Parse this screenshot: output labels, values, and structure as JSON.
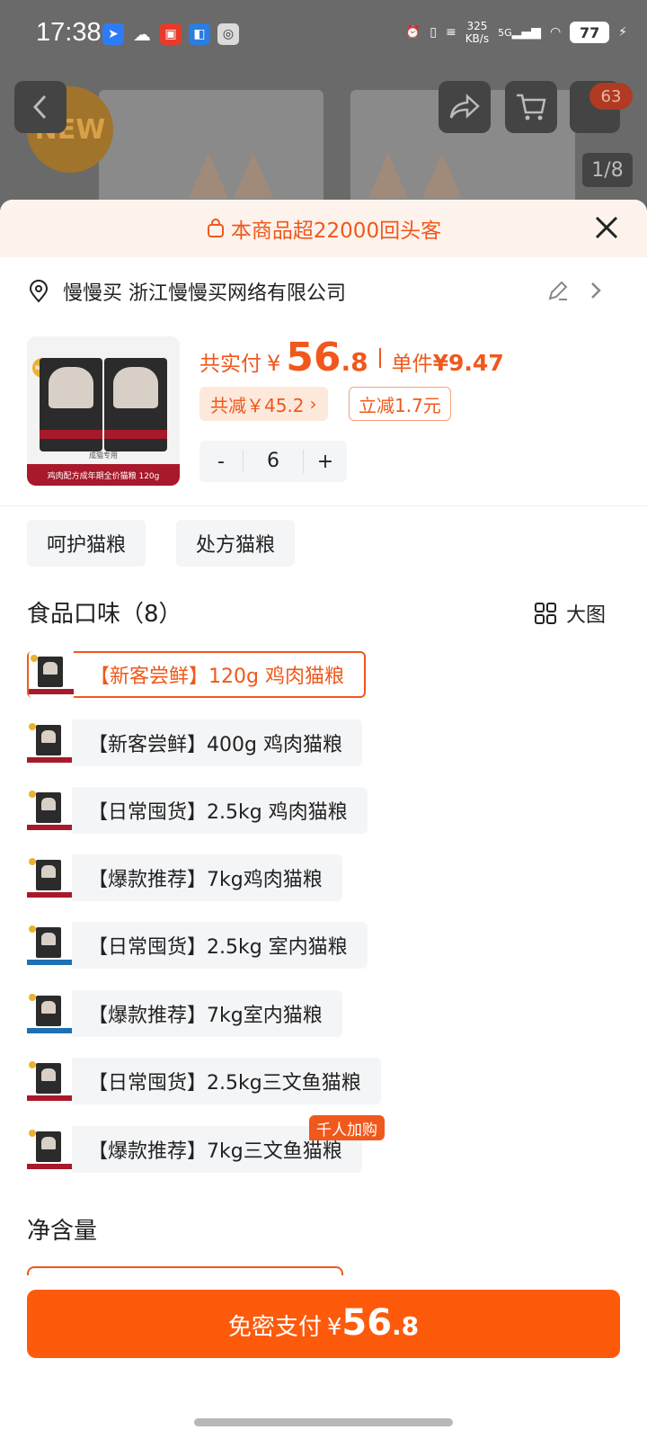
{
  "status_bar": {
    "time": "17:38",
    "net_speed_value": "325",
    "net_speed_unit": "KB/s",
    "network": "5G",
    "battery": "77"
  },
  "background": {
    "new_badge": "NEW",
    "cart_count": "63",
    "image_page": "1/8"
  },
  "banner": {
    "text": "本商品超22000回头客"
  },
  "address": {
    "text": "慢慢买 浙江慢慢买网络有限公司"
  },
  "product_image": {
    "badge": "NEW",
    "pack_subtitle": "成猫专用",
    "ribbon": "鸡肉配方成年期全价猫粮 120g"
  },
  "price": {
    "label": "共实付",
    "currency": "¥",
    "integer": "56",
    "decimal": ".8",
    "unit_label": "单件",
    "unit_price": "¥9.47"
  },
  "discounts": {
    "total_saving": "共减￥45.2",
    "total_saving_chevron": "›",
    "direct_saving": "立减1.7元"
  },
  "quantity": {
    "minus": "-",
    "value": "6",
    "plus": "+"
  },
  "categories": [
    "呵护猫粮",
    "处方猫粮"
  ],
  "flavors": {
    "title": "食品口味（8）",
    "big_view_label": "大图",
    "items": [
      {
        "label": "【新客尝鲜】120g 鸡肉猫粮",
        "selected": true,
        "theme": "red"
      },
      {
        "label": "【新客尝鲜】400g 鸡肉猫粮",
        "selected": false,
        "theme": "red"
      },
      {
        "label": "【日常囤货】2.5kg 鸡肉猫粮",
        "selected": false,
        "theme": "red"
      },
      {
        "label": "【爆款推荐】7kg鸡肉猫粮",
        "selected": false,
        "theme": "red"
      },
      {
        "label": "【日常囤货】2.5kg 室内猫粮",
        "selected": false,
        "theme": "blue"
      },
      {
        "label": "【爆款推荐】7kg室内猫粮",
        "selected": false,
        "theme": "blue"
      },
      {
        "label": "【日常囤货】2.5kg三文鱼猫粮",
        "selected": false,
        "theme": "red"
      },
      {
        "label": "【爆款推荐】7kg三文鱼猫粮",
        "selected": false,
        "theme": "red",
        "tag": "千人加购"
      }
    ]
  },
  "net_weight": {
    "title": "净含量"
  },
  "footer": {
    "pay_label": "免密支付",
    "currency": "¥",
    "integer": "56",
    "decimal": ".8"
  },
  "colors": {
    "accent": "#fe5a0c",
    "accent_text": "#f0581c",
    "chip_bg": "#f4f5f7"
  }
}
